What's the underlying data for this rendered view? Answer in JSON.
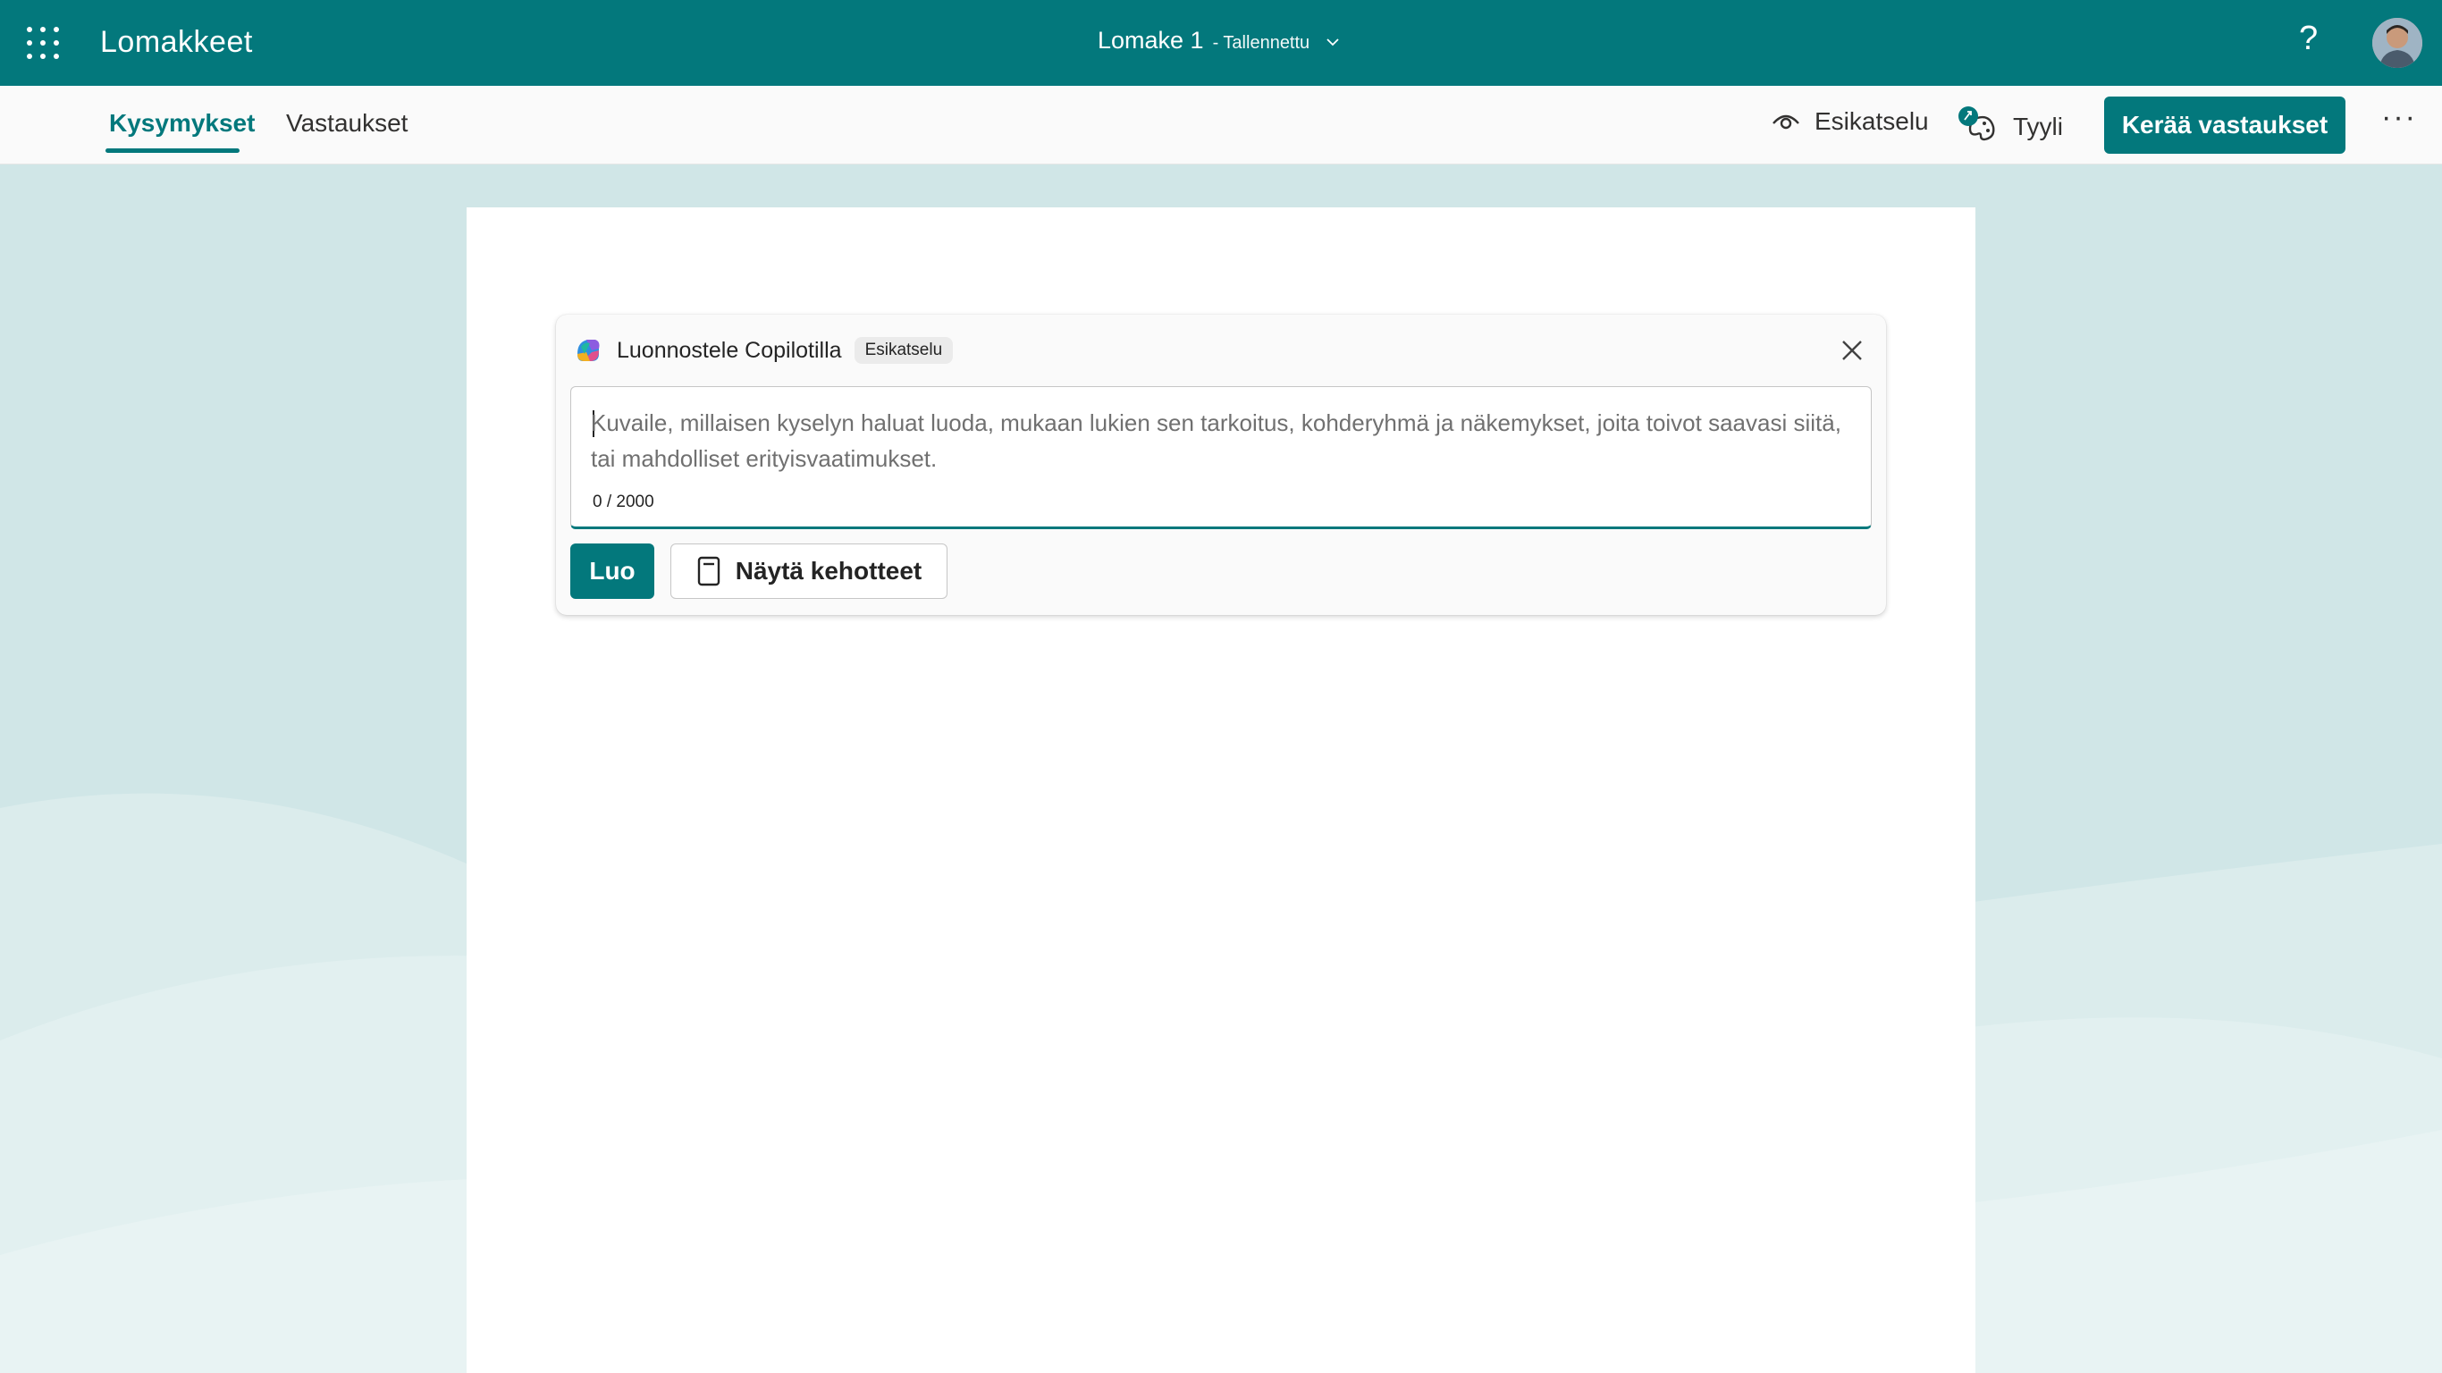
{
  "appbar": {
    "app_name": "Lomakkeet",
    "form_name": "Lomake 1",
    "save_status": "- Tallennettu",
    "help_glyph": "?",
    "icons": {
      "launcher": "app-launcher-icon",
      "dropdown": "chevron-down-icon",
      "help": "help-icon",
      "avatar": "user-avatar"
    },
    "color": "#03787c"
  },
  "cmdbar": {
    "tabs": [
      {
        "label": "Kysymykset",
        "active": true
      },
      {
        "label": "Vastaukset",
        "active": false
      }
    ],
    "preview_label": "Esikatselu",
    "style_label": "Tyyli",
    "collect_label": "Kerää vastaukset",
    "more_glyph": "···",
    "icons": {
      "preview": "eye-icon",
      "style": "palette-icon",
      "more": "more-icon"
    }
  },
  "copilot": {
    "title": "Luonnostele Copilotilla",
    "badge": "Esikatselu",
    "prompt_placeholder": "Kuvaile, millaisen kyselyn haluat luoda, mukaan lukien sen tarkoitus, kohderyhmä ja näkemykset, joita toivot saavasi siitä, tai mahdolliset erityisvaatimukset.",
    "prompt_value": "",
    "char_count": "0 / 2000",
    "create_label": "Luo",
    "show_prompts_label": "Näytä kehotteet",
    "icons": {
      "logo": "copilot-logo-icon",
      "close": "close-icon",
      "prompts": "notebook-icon"
    }
  },
  "colors": {
    "accent": "#03787c",
    "background": "#d4e8e9",
    "paper": "#ffffff"
  }
}
